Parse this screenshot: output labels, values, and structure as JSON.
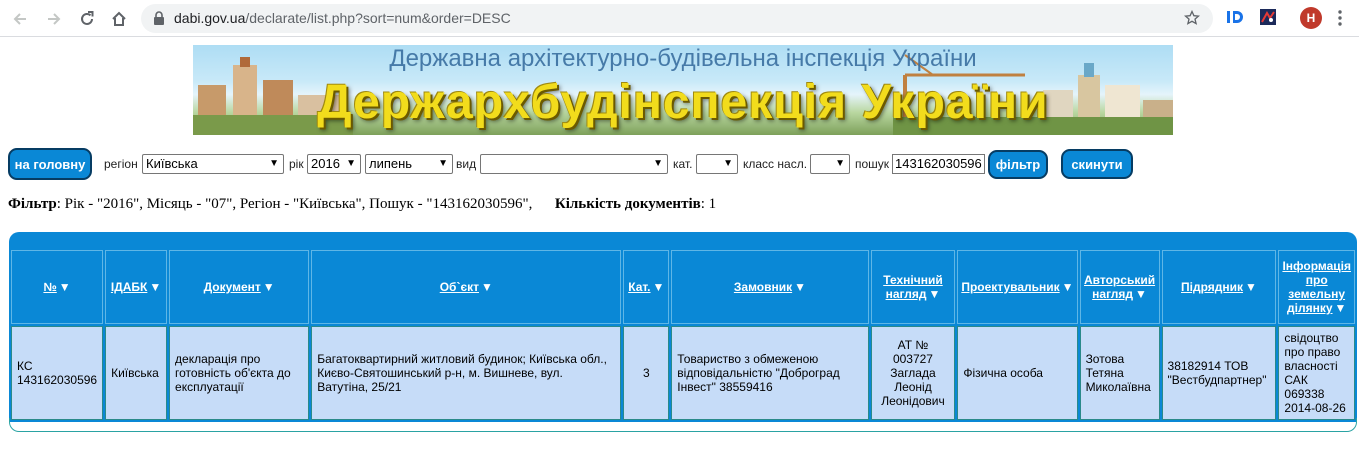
{
  "browser": {
    "url_host": "dabi.gov.ua",
    "url_path": "/declarate/list.php?sort=num&order=DESC",
    "avatar_letter": "Н"
  },
  "banner": {
    "subtitle": "Державна архітектурно-будівельна інспекція України",
    "title": "Держархбудінспекція України"
  },
  "toolbar": {
    "home_label": "на головну",
    "region_label": "регіон",
    "region_value": "Київська",
    "year_label": "рік",
    "year_value": "2016",
    "month_value": "липень",
    "type_label": "вид",
    "type_value": "",
    "cat_label": "кат.",
    "cat_value": "",
    "class_label": "класс насл.",
    "class_value": "",
    "search_label": "пошук",
    "search_value": "143162030596",
    "filter_label": "фільтр",
    "reset_label": "скинути"
  },
  "filter_summary": {
    "filter_bold": "Фільтр",
    "filter_text": ": Рік - \"2016\", Місяць - \"07\", Регіон - \"Київська\", Пошук - \"143162030596\",",
    "count_bold": "Кількість документів",
    "count_text": ": 1"
  },
  "table": {
    "headers": [
      {
        "line1": "№",
        "line2": ""
      },
      {
        "line1": "ІДАБК",
        "line2": ""
      },
      {
        "line1": "Документ",
        "line2": ""
      },
      {
        "line1": "Об`єкт",
        "line2": ""
      },
      {
        "line1": "Кат.",
        "line2": ""
      },
      {
        "line1": "Замовник",
        "line2": ""
      },
      {
        "line1": "Технічний",
        "line2": "нагляд"
      },
      {
        "line1": "Проектувальник",
        "line2": ""
      },
      {
        "line1": "Авторський",
        "line2": "нагляд"
      },
      {
        "line1": "Підрядник",
        "line2": ""
      },
      {
        "line1": "Інформація про земельну",
        "line2": "ділянку"
      }
    ],
    "rows": [
      {
        "num": "КС 143162030596",
        "idabk": "Київська",
        "document": "декларація про готовність об'єкта до експлуатації",
        "object": "Багатоквартирний житловий будинок; Київська обл., Києво-Святошинський р-н, м. Вишневе, вул. Ватутіна, 25/21",
        "cat": "3",
        "customer": "Товариство з обмеженою відповідальністю \"Доброград Інвест\" 38559416",
        "tech_supervision": "АТ № 003727 Заглада Леонід Леонідович",
        "designer": "Фізична особа",
        "author_supervision": "Зотова Тетяна Миколаївна",
        "contractor": "38182914 ТОВ \"Вестбудпартнер\"",
        "land_info": "свідоцтво про право власності САК 069338 2014-08-26"
      }
    ]
  },
  "colors": {
    "accent": "#0a88d6",
    "cell_bg": "#c6dcf8",
    "banner_title": "#f2dc1c"
  }
}
